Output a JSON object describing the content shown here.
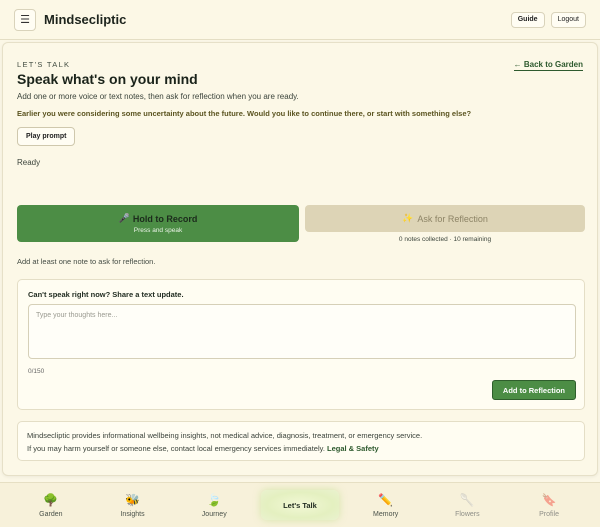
{
  "header": {
    "menu_icon": "☰",
    "app_title": "Mindsecliptic",
    "guide_label": "Guide",
    "logout_label": "Logout"
  },
  "main": {
    "eyebrow": "LET'S TALK",
    "back_link": "← Back to Garden",
    "title": "Speak what's on your mind",
    "subtitle": "Add one or more voice or text notes, then ask for reflection when you are ready.",
    "prompt": "Earlier you were considering some uncertainty about the future. Would you like to continue there, or start with something else?",
    "play_prompt_label": "Play prompt",
    "status": "Ready",
    "record": {
      "icon": "🎤",
      "label": "Hold to Record",
      "sublabel": "Press and speak"
    },
    "reflect": {
      "icon": "✨",
      "label": "Ask for Reflection",
      "notes_count": "0 notes collected · 10 remaining"
    },
    "hint": "Add at least one note to ask for reflection.",
    "text_update": {
      "title": "Can't speak right now? Share a text update.",
      "placeholder": "Type your thoughts here...",
      "char_count": "0/150",
      "add_label": "Add to Reflection"
    },
    "disclaimer": {
      "line1": "Mindsecliptic provides informational wellbeing insights, not medical advice, diagnosis, treatment, or emergency service.",
      "line2": "If you may harm yourself or someone else, contact local emergency services immediately.",
      "legal_link": "Legal & Safety"
    }
  },
  "nav": {
    "items": [
      {
        "label": "Garden",
        "icon": "🌳"
      },
      {
        "label": "Insights",
        "icon": "🐝"
      },
      {
        "label": "Journey",
        "icon": "🍃"
      },
      {
        "label": "Let's Talk"
      },
      {
        "label": "Memory",
        "icon": "✏️"
      },
      {
        "label": "Flowers",
        "icon": "🥄"
      },
      {
        "label": "Profile",
        "icon": "🔖"
      }
    ]
  },
  "colors": {
    "accent_green": "#4c8d45",
    "background": "#fbf7e6",
    "disabled_button": "#ddd4b6",
    "link_green": "#2e5a2e"
  }
}
